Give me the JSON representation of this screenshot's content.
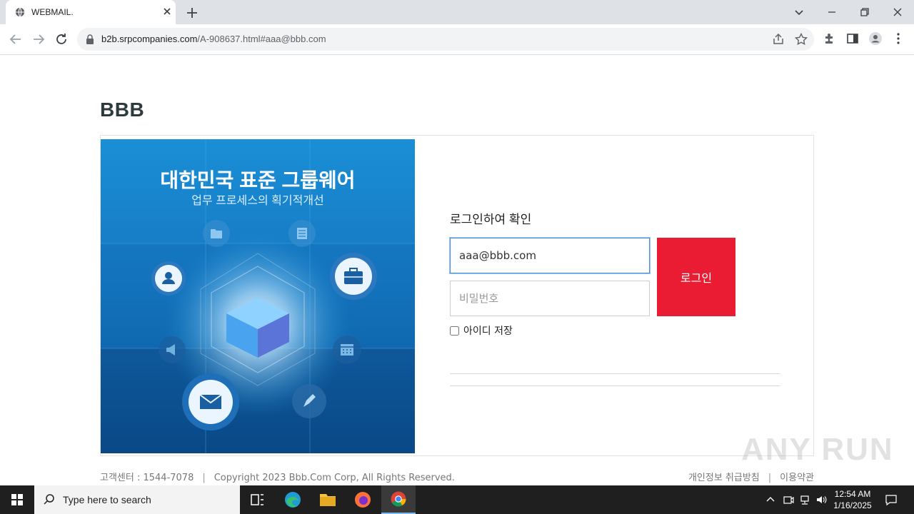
{
  "browser": {
    "tab_title": "WEBMAIL.",
    "url_host": "b2b.srpcompanies.com",
    "url_path": "/A-908637.html#aaa@bbb.com"
  },
  "page": {
    "brand": "BBB",
    "hero": {
      "headline": "대한민국 표준 그룹웨어",
      "subheadline": "업무 프로세스의 획기적개선"
    },
    "login": {
      "title": "로그인하여 확인",
      "email_value": "aaa@bbb.com",
      "password_placeholder": "비밀번호",
      "login_button": "로그인",
      "remember_label": "아이디 저장"
    },
    "footer": {
      "support": "고객센터 : 1544-7078",
      "copyright": "Copyright 2023 Bbb.Com Corp, All Rights Reserved.",
      "privacy": "개인정보 취급방침",
      "terms": "이용약관"
    },
    "watermark": "ANY RUN"
  },
  "taskbar": {
    "search_placeholder": "Type here to search",
    "time": "12:54 AM",
    "date": "1/16/2025"
  },
  "colors": {
    "login_button": "#ea1c33",
    "hero_blue": "#1677c1",
    "brand_text": "#2f3a3f"
  }
}
